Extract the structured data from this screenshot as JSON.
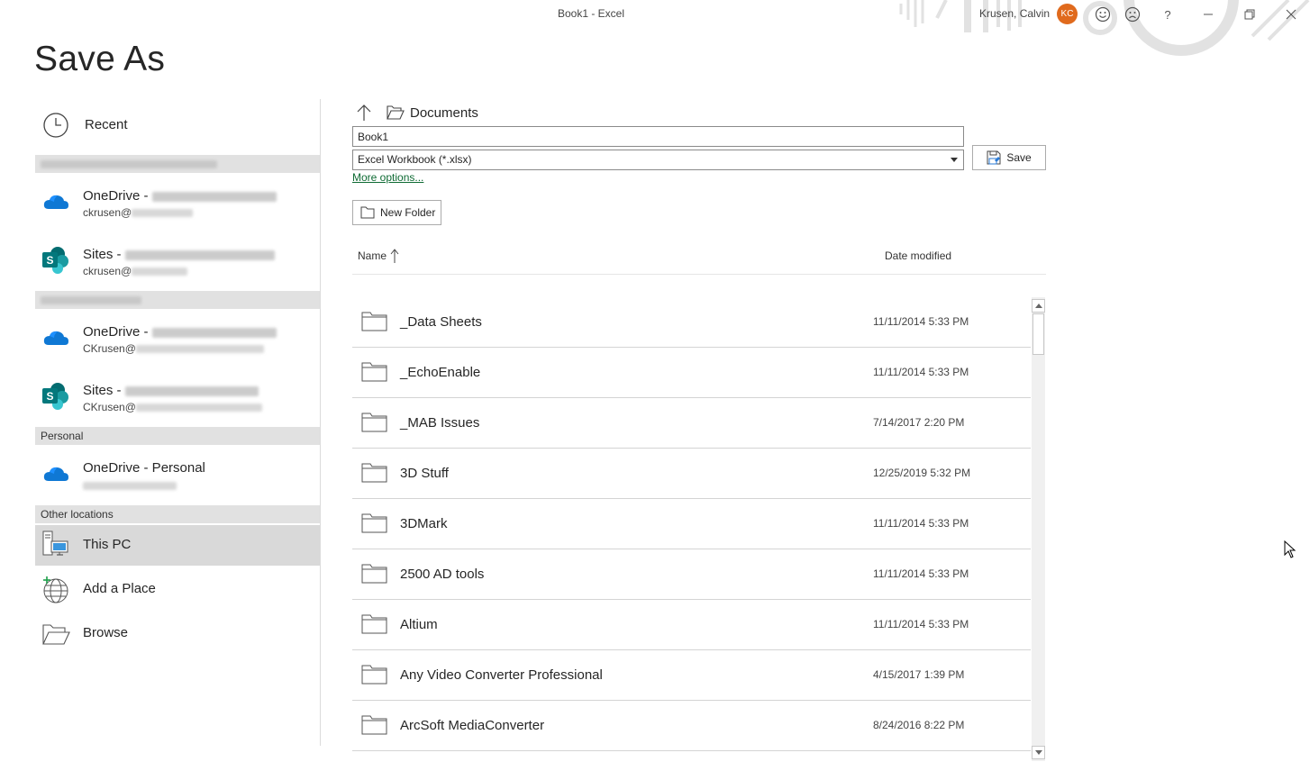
{
  "window": {
    "title": "Book1  -  Excel",
    "user_name": "Krusen, Calvin",
    "avatar_initials": "KC",
    "buttons": [
      "smiley-icon",
      "frown-icon",
      "help-icon",
      "minimize-icon",
      "restore-icon",
      "close-icon"
    ],
    "help_glyph": "?"
  },
  "page": {
    "title": "Save As"
  },
  "locations": {
    "recent": "Recent",
    "group_1": [
      {
        "label": "OneDrive - ",
        "sub": "ckrusen@",
        "icon": "onedrive-icon"
      },
      {
        "label": "Sites - ",
        "sub": "ckrusen@",
        "icon": "sharepoint-icon"
      }
    ],
    "group_2": [
      {
        "label": "OneDrive - ",
        "sub": "CKrusen@",
        "icon": "onedrive-icon"
      },
      {
        "label": "Sites - ",
        "sub": "CKrusen@",
        "icon": "sharepoint-icon"
      }
    ],
    "personal_header": "Personal",
    "onedrive_personal": "OneDrive - Personal",
    "other_header": "Other locations",
    "this_pc": "This PC",
    "add_place": "Add a Place",
    "browse": "Browse",
    "selected_color": "#d9d9d9",
    "onedrive_color": "#0f78d4",
    "sharepoint_color": "#038387"
  },
  "save_panel": {
    "current_folder": "Documents",
    "filename": "Book1",
    "filetype": "Excel Workbook (*.xlsx)",
    "save_label": "Save",
    "more_options": "More options...",
    "new_folder": "New Folder",
    "col_name": "Name",
    "col_date": "Date modified",
    "link_color": "#0f6b34"
  },
  "files": [
    {
      "name": "_Data Sheets",
      "date": "11/11/2014 5:33 PM"
    },
    {
      "name": "_EchoEnable",
      "date": "11/11/2014 5:33 PM"
    },
    {
      "name": "_MAB Issues",
      "date": "7/14/2017 2:20 PM"
    },
    {
      "name": "3D Stuff",
      "date": "12/25/2019 5:32 PM"
    },
    {
      "name": "3DMark",
      "date": "11/11/2014 5:33 PM"
    },
    {
      "name": "2500 AD tools",
      "date": "11/11/2014 5:33 PM"
    },
    {
      "name": "Altium",
      "date": "11/11/2014 5:33 PM"
    },
    {
      "name": "Any Video Converter Professional",
      "date": "4/15/2017 1:39 PM"
    },
    {
      "name": "ArcSoft MediaConverter",
      "date": "8/24/2016 8:22 PM"
    }
  ]
}
